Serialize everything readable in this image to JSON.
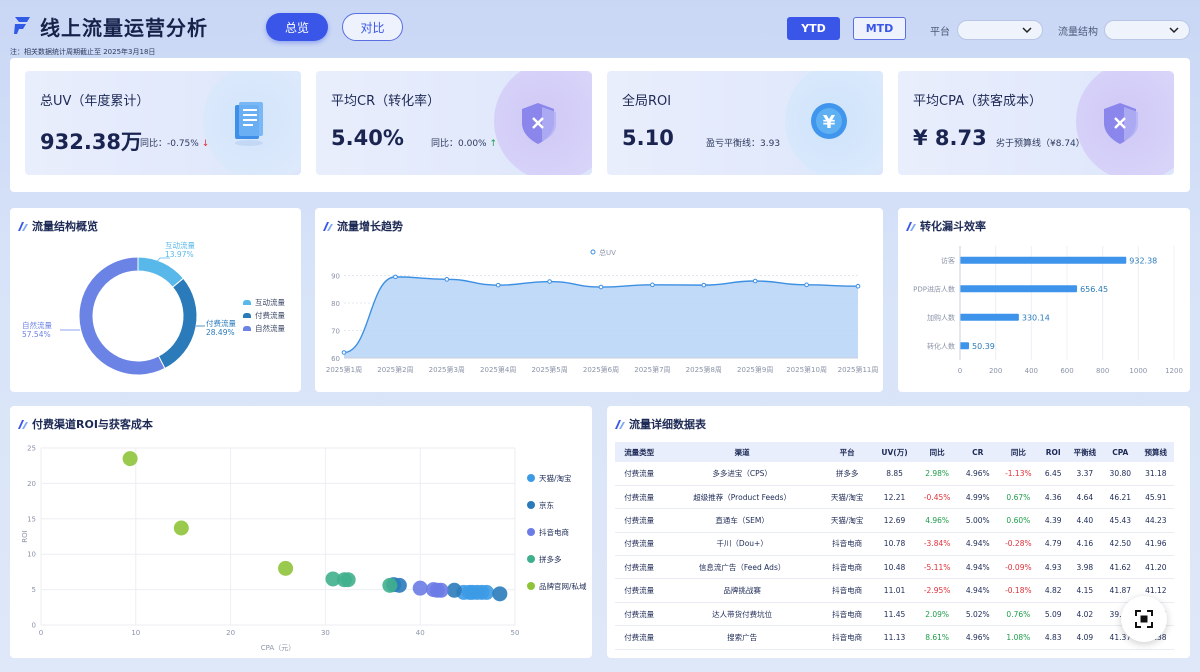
{
  "header": {
    "title": "线上流量运营分析",
    "note": "注：相关数据统计周期截止至 2025年3月18日",
    "tabs": [
      "总览",
      "对比"
    ],
    "periods": [
      "YTD",
      "MTD"
    ],
    "filters": [
      {
        "label": "平台",
        "value": ""
      },
      {
        "label": "流量结构",
        "value": ""
      }
    ]
  },
  "kpis": [
    {
      "label": "总UV（年度累计）",
      "value": "932.38万",
      "sub": "同比：-0.75%",
      "trend": "down",
      "icon": "document-icon"
    },
    {
      "label": "平均CR（转化率）",
      "value": "5.40%",
      "sub": "同比：0.00%",
      "trend": "up",
      "icon": "shield-icon"
    },
    {
      "label": "全局ROI",
      "value": "5.10",
      "sub": "盈亏平衡线：3.93",
      "trend": "",
      "icon": "yen-coin-icon"
    },
    {
      "label": "平均CPA（获客成本）",
      "value": "¥ 8.73",
      "sub": "劣于预算线（¥8.74）",
      "trend": "",
      "icon": "shield-icon"
    }
  ],
  "panels": {
    "structure": "流量结构概览",
    "trend": "流量增长趋势",
    "funnel": "转化漏斗效率",
    "scatter": "付费渠道ROI与获客成本",
    "table": "流量详细数据表"
  },
  "colors": {
    "accent": "#3a56e8",
    "interactive": "#59b8ea",
    "paid": "#2b7bba",
    "natural": "#6c83e6",
    "pos": "#1e9c4a",
    "neg": "#e0323a"
  },
  "chart_data": [
    {
      "type": "pie",
      "variant": "donut",
      "labels": [
        "互动流量",
        "付费流量",
        "自然流量"
      ],
      "values": [
        13.97,
        28.49,
        57.54
      ],
      "display": [
        "13.97%",
        "28.49%",
        "57.54%"
      ],
      "colors": [
        "#59b8ea",
        "#2b7bba",
        "#6c83e6"
      ],
      "legend": "right"
    },
    {
      "type": "area",
      "series": [
        {
          "name": "总UV",
          "values": [
            62,
            89.5,
            88.6,
            86.5,
            87.8,
            85.8,
            86.6,
            86.5,
            88,
            86.6,
            86.1
          ]
        }
      ],
      "categories": [
        "2025第1周",
        "2025第2周",
        "2025第3周",
        "2025第4周",
        "2025第5周",
        "2025第6周",
        "2025第7周",
        "2025第8周",
        "2025第9周",
        "2025第10周",
        "2025第11周"
      ],
      "yticks": [
        60,
        70,
        80,
        90
      ],
      "ylim": [
        60,
        92
      ],
      "legend": "top"
    },
    {
      "type": "bar",
      "orientation": "horizontal",
      "categories": [
        "访客",
        "PDP进店人数",
        "加购人数",
        "转化人数"
      ],
      "values": [
        932.38,
        656.45,
        330.14,
        50.39
      ],
      "labels": [
        "932.38",
        "656.45",
        "330.14",
        "50.39"
      ],
      "xticks": [
        0,
        200,
        400,
        600,
        800,
        1000,
        1200
      ],
      "xlim": [
        0,
        1200
      ]
    },
    {
      "type": "scatter",
      "xlabel": "CPA（元）",
      "ylabel": "ROI",
      "xlim": [
        0,
        50
      ],
      "ylim": [
        0,
        25
      ],
      "xticks": [
        0,
        10,
        20,
        30,
        40,
        50
      ],
      "yticks": [
        0,
        5,
        10,
        15,
        20,
        25
      ],
      "legend": "right",
      "series": [
        {
          "name": "天猫/淘宝",
          "color": "#3d9be6",
          "points": [
            [
              44.6,
              4.6
            ],
            [
              45.2,
              4.6
            ],
            [
              45.5,
              4.6
            ],
            [
              46.0,
              4.6
            ],
            [
              46.5,
              4.6
            ],
            [
              47.0,
              4.6
            ]
          ]
        },
        {
          "name": "京东",
          "color": "#2b7bba",
          "points": [
            [
              43.6,
              4.9
            ],
            [
              48.4,
              4.4
            ],
            [
              37.2,
              5.7
            ],
            [
              37.8,
              5.6
            ]
          ]
        },
        {
          "name": "抖音电商",
          "color": "#6c7be6",
          "points": [
            [
              40.0,
              5.2
            ],
            [
              41.4,
              5.0
            ],
            [
              42.2,
              4.9
            ],
            [
              41.8,
              4.9
            ]
          ]
        },
        {
          "name": "拼多多",
          "color": "#40b08c",
          "points": [
            [
              30.8,
              6.5
            ],
            [
              32.0,
              6.4
            ],
            [
              32.4,
              6.4
            ],
            [
              36.8,
              5.6
            ]
          ]
        },
        {
          "name": "品牌官网/私域",
          "color": "#8fc43a",
          "points": [
            [
              9.4,
              23.5
            ],
            [
              14.8,
              13.7
            ],
            [
              25.8,
              8.0
            ]
          ]
        }
      ]
    }
  ],
  "table": {
    "columns": [
      "流量类型",
      "渠道",
      "平台",
      "UV(万)",
      "同比",
      "CR",
      "同比",
      "ROI",
      "平衡线",
      "CPA",
      "预算线"
    ],
    "rows": [
      [
        "付费流量",
        "多多进宝（CPS）",
        "拼多多",
        "8.85",
        "2.98%",
        "4.96%",
        "-1.13%",
        "6.45",
        "3.37",
        "30.80",
        "31.18"
      ],
      [
        "付费流量",
        "超级推荐（Product Feeds）",
        "天猫/淘宝",
        "12.21",
        "-0.45%",
        "4.99%",
        "0.67%",
        "4.36",
        "4.64",
        "46.21",
        "45.91"
      ],
      [
        "付费流量",
        "直通车（SEM）",
        "天猫/淘宝",
        "12.69",
        "4.96%",
        "5.00%",
        "0.60%",
        "4.39",
        "4.40",
        "45.43",
        "44.23"
      ],
      [
        "付费流量",
        "千川（Dou+）",
        "抖音电商",
        "10.78",
        "-3.84%",
        "4.94%",
        "-0.28%",
        "4.79",
        "4.16",
        "42.50",
        "41.96"
      ],
      [
        "付费流量",
        "信息流广告（Feed Ads）",
        "抖音电商",
        "10.48",
        "-5.11%",
        "4.94%",
        "-0.09%",
        "4.93",
        "3.98",
        "41.62",
        "41.20"
      ],
      [
        "付费流量",
        "品牌挑战赛",
        "抖音电商",
        "11.01",
        "-2.95%",
        "4.94%",
        "-0.18%",
        "4.82",
        "4.15",
        "41.87",
        "41.12"
      ],
      [
        "付费流量",
        "达人带货付费坑位",
        "抖音电商",
        "11.45",
        "2.09%",
        "5.02%",
        "0.76%",
        "5.09",
        "4.02",
        "39.96",
        "39.47"
      ],
      [
        "付费流量",
        "搜索广告",
        "抖音电商",
        "11.13",
        "8.61%",
        "4.96%",
        "1.08%",
        "4.83",
        "4.09",
        "41.37",
        "40.38"
      ]
    ]
  }
}
